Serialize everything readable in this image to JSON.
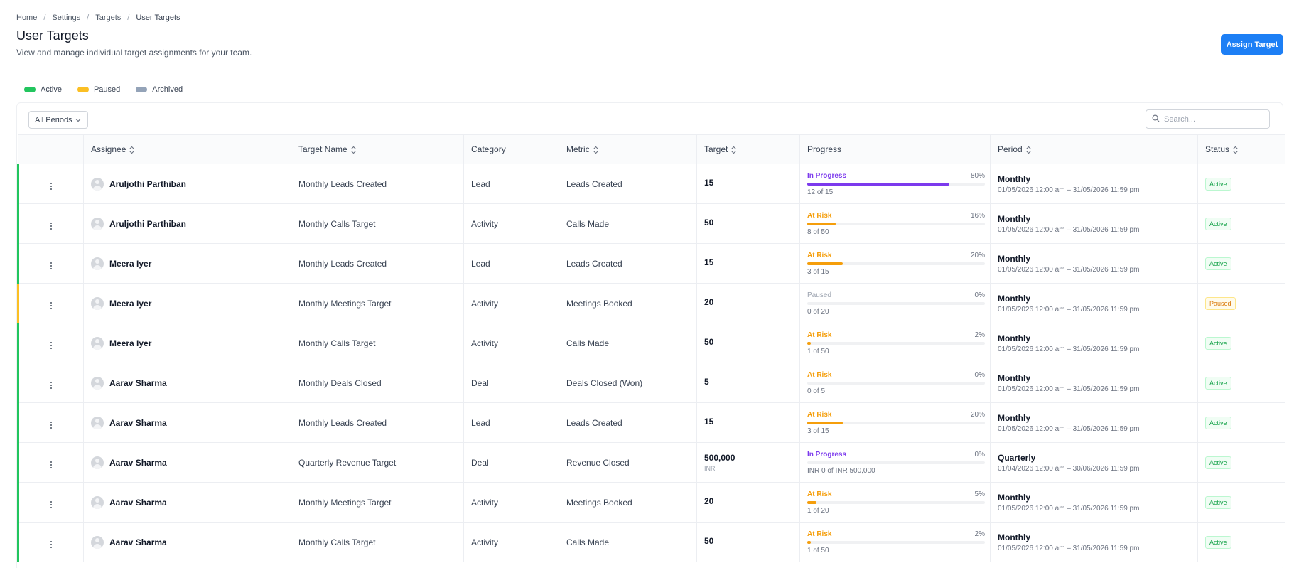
{
  "breadcrumb": [
    "Home",
    "Settings",
    "Targets",
    "User Targets"
  ],
  "page": {
    "title": "User Targets",
    "subtitle": "View and manage individual target assignments for your team."
  },
  "assign_button": "Assign Target",
  "legend": [
    {
      "label": "Active",
      "color": "#22c55e"
    },
    {
      "label": "Paused",
      "color": "#fbbf24"
    },
    {
      "label": "Archived",
      "color": "#94a3b8"
    }
  ],
  "filter": {
    "period": "All Periods"
  },
  "search": {
    "placeholder": "Search..."
  },
  "columns": [
    "Assignee",
    "Target Name",
    "Category",
    "Metric",
    "Target",
    "Progress",
    "Period",
    "Status"
  ],
  "colors": {
    "in_progress": "#7c3aed",
    "at_risk": "#f59e0b",
    "paused": "#9ca3af",
    "primary": "#1d7ff5"
  },
  "rows": [
    {
      "assignee": "Aruljothi Parthiban",
      "target_name": "Monthly Leads Created",
      "category": "Lead",
      "metric": "Leads Created",
      "target": "15",
      "unit": "",
      "progress_label": "In Progress",
      "progress_state": "in_progress",
      "progress_pct": "80%",
      "progress_value": 0.8,
      "progress_detail": "12 of 15",
      "period": "Monthly",
      "period_range": "01/05/2026 12:00 am – 31/05/2026 11:59 pm",
      "status": "Active",
      "status_state": "active"
    },
    {
      "assignee": "Aruljothi Parthiban",
      "target_name": "Monthly Calls Target",
      "category": "Activity",
      "metric": "Calls Made",
      "target": "50",
      "unit": "",
      "progress_label": "At Risk",
      "progress_state": "at_risk",
      "progress_pct": "16%",
      "progress_value": 0.16,
      "progress_detail": "8 of 50",
      "period": "Monthly",
      "period_range": "01/05/2026 12:00 am – 31/05/2026 11:59 pm",
      "status": "Active",
      "status_state": "active"
    },
    {
      "assignee": "Meera Iyer",
      "target_name": "Monthly Leads Created",
      "category": "Lead",
      "metric": "Leads Created",
      "target": "15",
      "unit": "",
      "progress_label": "At Risk",
      "progress_state": "at_risk",
      "progress_pct": "20%",
      "progress_value": 0.2,
      "progress_detail": "3 of 15",
      "period": "Monthly",
      "period_range": "01/05/2026 12:00 am – 31/05/2026 11:59 pm",
      "status": "Active",
      "status_state": "active"
    },
    {
      "assignee": "Meera Iyer",
      "target_name": "Monthly Meetings Target",
      "category": "Activity",
      "metric": "Meetings Booked",
      "target": "20",
      "unit": "",
      "progress_label": "Paused",
      "progress_state": "paused",
      "progress_pct": "0%",
      "progress_value": 0,
      "progress_detail": "0 of 20",
      "period": "Monthly",
      "period_range": "01/05/2026 12:00 am – 31/05/2026 11:59 pm",
      "status": "Paused",
      "status_state": "paused"
    },
    {
      "assignee": "Meera Iyer",
      "target_name": "Monthly Calls Target",
      "category": "Activity",
      "metric": "Calls Made",
      "target": "50",
      "unit": "",
      "progress_label": "At Risk",
      "progress_state": "at_risk",
      "progress_pct": "2%",
      "progress_value": 0.02,
      "progress_detail": "1 of 50",
      "period": "Monthly",
      "period_range": "01/05/2026 12:00 am – 31/05/2026 11:59 pm",
      "status": "Active",
      "status_state": "active"
    },
    {
      "assignee": "Aarav Sharma",
      "target_name": "Monthly Deals Closed",
      "category": "Deal",
      "metric": "Deals Closed (Won)",
      "target": "5",
      "unit": "",
      "progress_label": "At Risk",
      "progress_state": "at_risk",
      "progress_pct": "0%",
      "progress_value": 0,
      "progress_detail": "0 of 5",
      "period": "Monthly",
      "period_range": "01/05/2026 12:00 am – 31/05/2026 11:59 pm",
      "status": "Active",
      "status_state": "active"
    },
    {
      "assignee": "Aarav Sharma",
      "target_name": "Monthly Leads Created",
      "category": "Lead",
      "metric": "Leads Created",
      "target": "15",
      "unit": "",
      "progress_label": "At Risk",
      "progress_state": "at_risk",
      "progress_pct": "20%",
      "progress_value": 0.2,
      "progress_detail": "3 of 15",
      "period": "Monthly",
      "period_range": "01/05/2026 12:00 am – 31/05/2026 11:59 pm",
      "status": "Active",
      "status_state": "active"
    },
    {
      "assignee": "Aarav Sharma",
      "target_name": "Quarterly Revenue Target",
      "category": "Deal",
      "metric": "Revenue Closed",
      "target": "500,000",
      "unit": "INR",
      "progress_label": "In Progress",
      "progress_state": "in_progress",
      "progress_pct": "0%",
      "progress_value": 0,
      "progress_detail": "INR 0 of INR 500,000",
      "period": "Quarterly",
      "period_range": "01/04/2026 12:00 am – 30/06/2026 11:59 pm",
      "status": "Active",
      "status_state": "active"
    },
    {
      "assignee": "Aarav Sharma",
      "target_name": "Monthly Meetings Target",
      "category": "Activity",
      "metric": "Meetings Booked",
      "target": "20",
      "unit": "",
      "progress_label": "At Risk",
      "progress_state": "at_risk",
      "progress_pct": "5%",
      "progress_value": 0.05,
      "progress_detail": "1 of 20",
      "period": "Monthly",
      "period_range": "01/05/2026 12:00 am – 31/05/2026 11:59 pm",
      "status": "Active",
      "status_state": "active"
    },
    {
      "assignee": "Aarav Sharma",
      "target_name": "Monthly Calls Target",
      "category": "Activity",
      "metric": "Calls Made",
      "target": "50",
      "unit": "",
      "progress_label": "At Risk",
      "progress_state": "at_risk",
      "progress_pct": "2%",
      "progress_value": 0.02,
      "progress_detail": "1 of 50",
      "period": "Monthly",
      "period_range": "01/05/2026 12:00 am – 31/05/2026 11:59 pm",
      "status": "Active",
      "status_state": "active"
    }
  ]
}
